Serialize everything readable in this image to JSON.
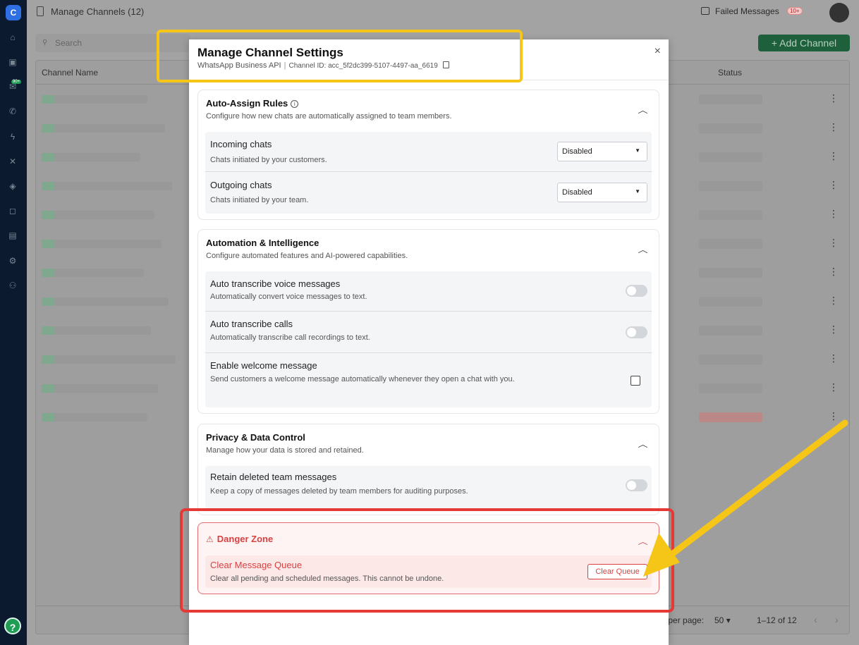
{
  "rail": {
    "logo": "C",
    "badge": "90+",
    "help": "?"
  },
  "topbar": {
    "title": "Manage Channels  (12)",
    "failed_label": "Failed Messages",
    "failed_badge": "10+"
  },
  "search": {
    "placeholder": "Search"
  },
  "add_button": "+ Add Channel",
  "table": {
    "col_channel": "Channel Name",
    "col_status": "Status",
    "row_count": 12
  },
  "pagination": {
    "rows_per_page_label": "Rows per page:",
    "rows_per_page_value": "50",
    "range": "1–12 of 12",
    "prev": "‹",
    "next": "›"
  },
  "modal": {
    "title": "Manage Channel Settings",
    "subtitle": "WhatsApp Business API",
    "separator": "|",
    "channel_id": "Channel ID: acc_5f2dc399-5107-4497-aa_6619",
    "close": "×",
    "auto_assign": {
      "title": "Auto-Assign Rules",
      "desc": "Configure how new chats are automatically assigned to team members.",
      "incoming": {
        "title": "Incoming chats",
        "desc": "Chats initiated by your customers.",
        "value": "Disabled"
      },
      "outgoing": {
        "title": "Outgoing chats",
        "desc": "Chats initiated by your team.",
        "value": "Disabled"
      }
    },
    "automation": {
      "title": "Automation & Intelligence",
      "desc": "Configure automated features and AI-powered capabilities.",
      "voice": {
        "title": "Auto transcribe voice messages",
        "desc": "Automatically convert voice messages to text.",
        "enabled": false
      },
      "calls": {
        "title": "Auto transcribe calls",
        "desc": "Automatically transcribe call recordings to text.",
        "enabled": false
      },
      "welcome": {
        "title": "Enable welcome message",
        "desc": "Send customers a welcome message automatically whenever they open a chat with you.",
        "checked": false
      }
    },
    "privacy": {
      "title": "Privacy & Data Control",
      "desc": "Manage how your data is stored and retained.",
      "retain": {
        "title": "Retain deleted team messages",
        "desc": "Keep a copy of messages deleted by team members for auditing purposes.",
        "enabled": false
      }
    },
    "danger": {
      "title": "Danger Zone",
      "clear_title": "Clear Message Queue",
      "clear_desc": "Clear all pending and scheduled messages. This cannot be undone.",
      "clear_button": "Clear Queue"
    }
  },
  "colors": {
    "highlight_yellow": "#f5c518",
    "highlight_red": "#e53935",
    "danger": "#d94141",
    "brand_green": "#1e5f3c"
  }
}
